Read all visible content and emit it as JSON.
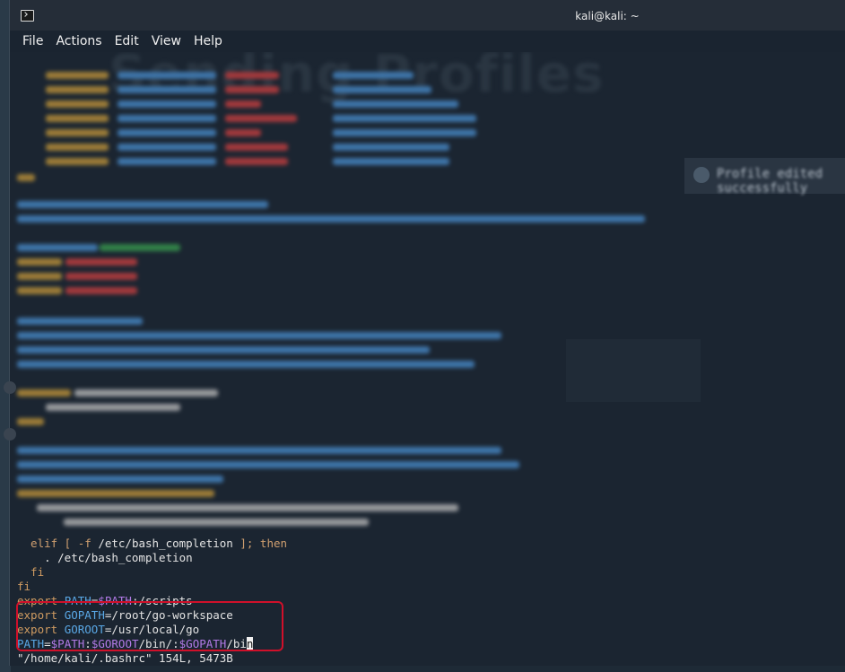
{
  "titlebar": {
    "title": "kali@kali: ~"
  },
  "menu": [
    "File",
    "Actions",
    "Edit",
    "View",
    "Help"
  ],
  "background": {
    "heading": "Sending Profiles",
    "toast": "Profile edited successfully"
  },
  "terminal": {
    "line_esac": "  . /etc/bash_completion",
    "line_elif_prefix": "  elif [ -f ",
    "line_elif_path": "/etc/bash_completion",
    "line_elif_suffix": " ]; then",
    "line_source": "    . /etc/bash_completion",
    "line_fi_inner": "  fi",
    "line_fi": "fi",
    "line_path_export": "export",
    "line_path_var": "PATH",
    "line_path_eq": "=",
    "line_path_ref": "$PATH",
    "line_path_rest": ":/scripts",
    "line_gopath_export": "export",
    "line_gopath_var": "GOPATH",
    "line_gopath_rest": "=/root/go-workspace",
    "line_goroot_export": "export",
    "line_goroot_var": "GOROOT",
    "line_goroot_rest": "=/usr/local/go",
    "line_path2_var": "PATH",
    "line_path2_eq": "=",
    "line_path2_ref1": "$PATH",
    "line_path2_sep1": ":",
    "line_path2_ref2": "$GOROOT",
    "line_path2_sep2": "/bin/:",
    "line_path2_ref3": "$GOPATH",
    "line_path2_tail": "/bi",
    "line_path2_cursor": "n",
    "status": "\"/home/kali/.bashrc\" 154L, 5473B"
  }
}
